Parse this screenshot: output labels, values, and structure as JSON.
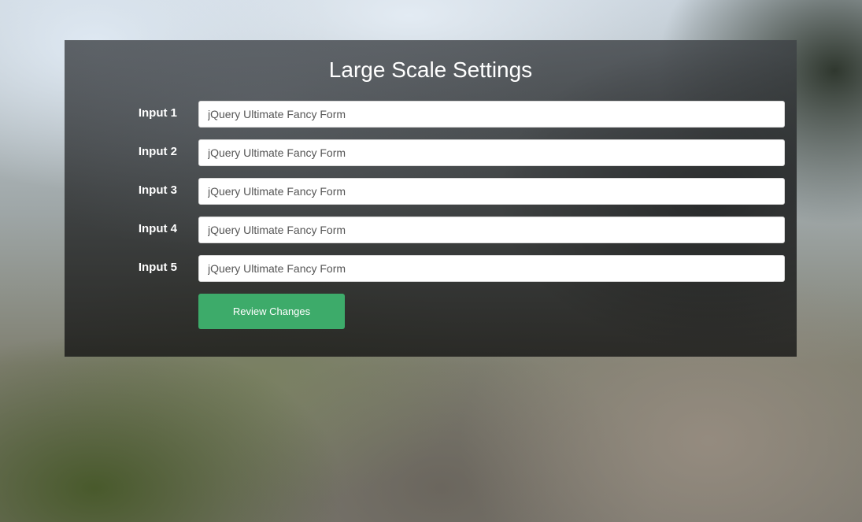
{
  "form": {
    "title": "Large Scale Settings",
    "fields": [
      {
        "label": "Input 1",
        "value": "jQuery Ultimate Fancy Form"
      },
      {
        "label": "Input 2",
        "value": "jQuery Ultimate Fancy Form"
      },
      {
        "label": "Input 3",
        "value": "jQuery Ultimate Fancy Form"
      },
      {
        "label": "Input 4",
        "value": "jQuery Ultimate Fancy Form"
      },
      {
        "label": "Input 5",
        "value": "jQuery Ultimate Fancy Form"
      }
    ],
    "submit_label": "Review Changes"
  },
  "colors": {
    "panel_background": "#2f3133",
    "button_accent": "#3dab6a",
    "label_text": "#ffffff",
    "input_text": "#555555"
  }
}
